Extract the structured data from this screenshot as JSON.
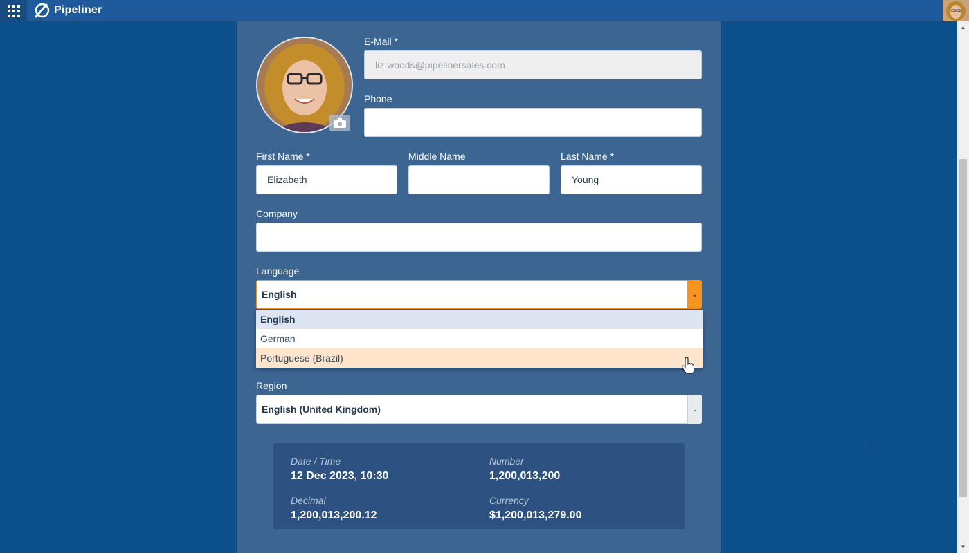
{
  "app": {
    "name": "Pipeliner"
  },
  "form": {
    "email": {
      "label": "E-Mail *",
      "value": "liz.woods@pipelinersales.com"
    },
    "phone": {
      "label": "Phone",
      "value": ""
    },
    "first_name": {
      "label": "First Name *",
      "value": "Elizabeth"
    },
    "middle_name": {
      "label": "Middle Name",
      "value": ""
    },
    "last_name": {
      "label": "Last Name *",
      "value": "Young"
    },
    "company": {
      "label": "Company",
      "value": ""
    },
    "language": {
      "label": "Language",
      "value": "English",
      "options": [
        "English",
        "German",
        "Portuguese (Brazil)"
      ]
    },
    "region": {
      "label": "Region",
      "value": "English (United Kingdom)"
    }
  },
  "preview": {
    "datetime": {
      "label": "Date / Time",
      "value": "12 Dec 2023, 10:30"
    },
    "number": {
      "label": "Number",
      "value": "1,200,013,200"
    },
    "decimal": {
      "label": "Decimal",
      "value": "1,200,013,200.12"
    },
    "currency": {
      "label": "Currency",
      "value": "$1,200,013,279.00"
    }
  },
  "colors": {
    "background": "#0b4f8c",
    "panel": "#3c6591",
    "accent": "#f6941e",
    "topbar": "#1f5b9c"
  }
}
